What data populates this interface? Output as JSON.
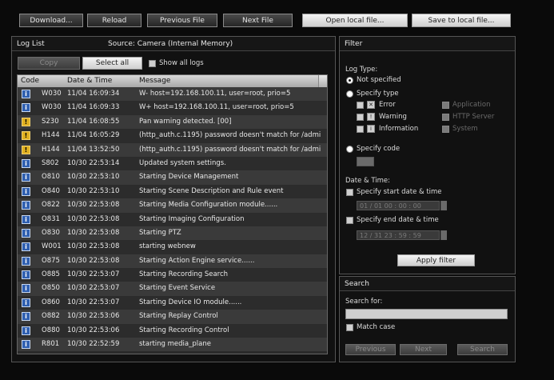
{
  "toolbar": {
    "download": "Download...",
    "reload": "Reload",
    "previous_file": "Previous File",
    "next_file": "Next File",
    "open_local": "Open local file...",
    "save_local": "Save to local file..."
  },
  "log_list": {
    "title": "Log List",
    "source": "Source:  Camera (Internal Memory)",
    "copy": "Copy",
    "select_all": "Select all",
    "show_all_logs": "Show all logs",
    "columns": [
      "Code",
      "Date & Time",
      "Message"
    ],
    "rows": [
      {
        "type": "info",
        "icon": "i",
        "code": "W030",
        "dt": "11/04 16:09:34",
        "msg": "W- host=192.168.100.11, user=root, prio=5"
      },
      {
        "type": "info",
        "icon": "i",
        "code": "W030",
        "dt": "11/04 16:09:33",
        "msg": "W+ host=192.168.100.11, user=root, prio=5"
      },
      {
        "type": "warn",
        "icon": "!",
        "code": "S230",
        "dt": "11/04 16:08:55",
        "msg": "Pan warning detected. [00]"
      },
      {
        "type": "warn",
        "icon": "!",
        "code": "H144",
        "dt": "11/04 16:05:29",
        "msg": "(http_auth.c.1195) password doesn't match for /admin"
      },
      {
        "type": "warn",
        "icon": "!",
        "code": "H144",
        "dt": "11/04 13:52:50",
        "msg": "(http_auth.c.1195) password doesn't match for /admin"
      },
      {
        "type": "info",
        "icon": "i",
        "code": "S802",
        "dt": "10/30 22:53:14",
        "msg": "Updated system settings."
      },
      {
        "type": "info",
        "icon": "i",
        "code": "O810",
        "dt": "10/30 22:53:10",
        "msg": "Starting Device Management"
      },
      {
        "type": "info",
        "icon": "i",
        "code": "O840",
        "dt": "10/30 22:53:10",
        "msg": "Starting Scene Description and Rule event"
      },
      {
        "type": "info",
        "icon": "i",
        "code": "O822",
        "dt": "10/30 22:53:08",
        "msg": "Starting Media Configuration module......"
      },
      {
        "type": "info",
        "icon": "i",
        "code": "O831",
        "dt": "10/30 22:53:08",
        "msg": "Starting Imaging Configuration"
      },
      {
        "type": "info",
        "icon": "i",
        "code": "O830",
        "dt": "10/30 22:53:08",
        "msg": "Starting PTZ"
      },
      {
        "type": "info",
        "icon": "i",
        "code": "W001",
        "dt": "10/30 22:53:08",
        "msg": "starting webnew"
      },
      {
        "type": "info",
        "icon": "i",
        "code": "O875",
        "dt": "10/30 22:53:08",
        "msg": "Starting Action Engine service......"
      },
      {
        "type": "info",
        "icon": "i",
        "code": "O885",
        "dt": "10/30 22:53:07",
        "msg": "Starting Recording Search"
      },
      {
        "type": "info",
        "icon": "i",
        "code": "O850",
        "dt": "10/30 22:53:07",
        "msg": "Starting Event Service"
      },
      {
        "type": "info",
        "icon": "i",
        "code": "O860",
        "dt": "10/30 22:53:07",
        "msg": "Starting Device IO module......"
      },
      {
        "type": "info",
        "icon": "i",
        "code": "O882",
        "dt": "10/30 22:53:06",
        "msg": "Starting Replay Control"
      },
      {
        "type": "info",
        "icon": "i",
        "code": "O880",
        "dt": "10/30 22:53:06",
        "msg": "Starting Recording Control"
      },
      {
        "type": "info",
        "icon": "i",
        "code": "R801",
        "dt": "10/30 22:52:59",
        "msg": "starting media_plane"
      }
    ]
  },
  "filter": {
    "title": "Filter",
    "log_type": "Log Type:",
    "not_specified": "Not specified",
    "specify_type": "Specify type",
    "types": [
      {
        "label": "Error",
        "icon": "✕"
      },
      {
        "label": "Warning",
        "icon": "!"
      },
      {
        "label": "Information",
        "icon": "i"
      }
    ],
    "types_disabled": [
      "Application",
      "HTTP Server",
      "System"
    ],
    "specify_code": "Specify code",
    "date_time": "Date & Time:",
    "start": "Specify start date & time",
    "start_value": "01 / 01  00 : 00 : 00",
    "end": "Specify end date & time",
    "end_value": "12 / 31  23 : 59 : 59",
    "apply": "Apply filter"
  },
  "search": {
    "title": "Search",
    "search_for": "Search for:",
    "match_case": "Match case",
    "previous": "Previous",
    "next": "Next",
    "search": "Search"
  }
}
